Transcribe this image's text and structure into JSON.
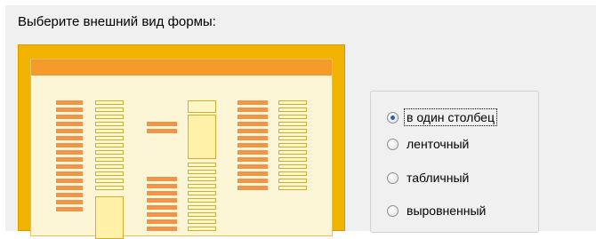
{
  "prompt": "Выберите внешний вид формы:",
  "layout_options": {
    "selected": "в один столбец",
    "items": [
      {
        "label": "в один столбец",
        "checked": true
      },
      {
        "label": "ленточный",
        "checked": false
      },
      {
        "label": "табличный",
        "checked": false
      },
      {
        "label": "выровненный",
        "checked": false
      }
    ]
  },
  "colors": {
    "preview_frame": "#f2b300",
    "preview_header": "#f39a2a",
    "label_bar": "#f0944a",
    "selected_dot": "#2a5fb8"
  }
}
